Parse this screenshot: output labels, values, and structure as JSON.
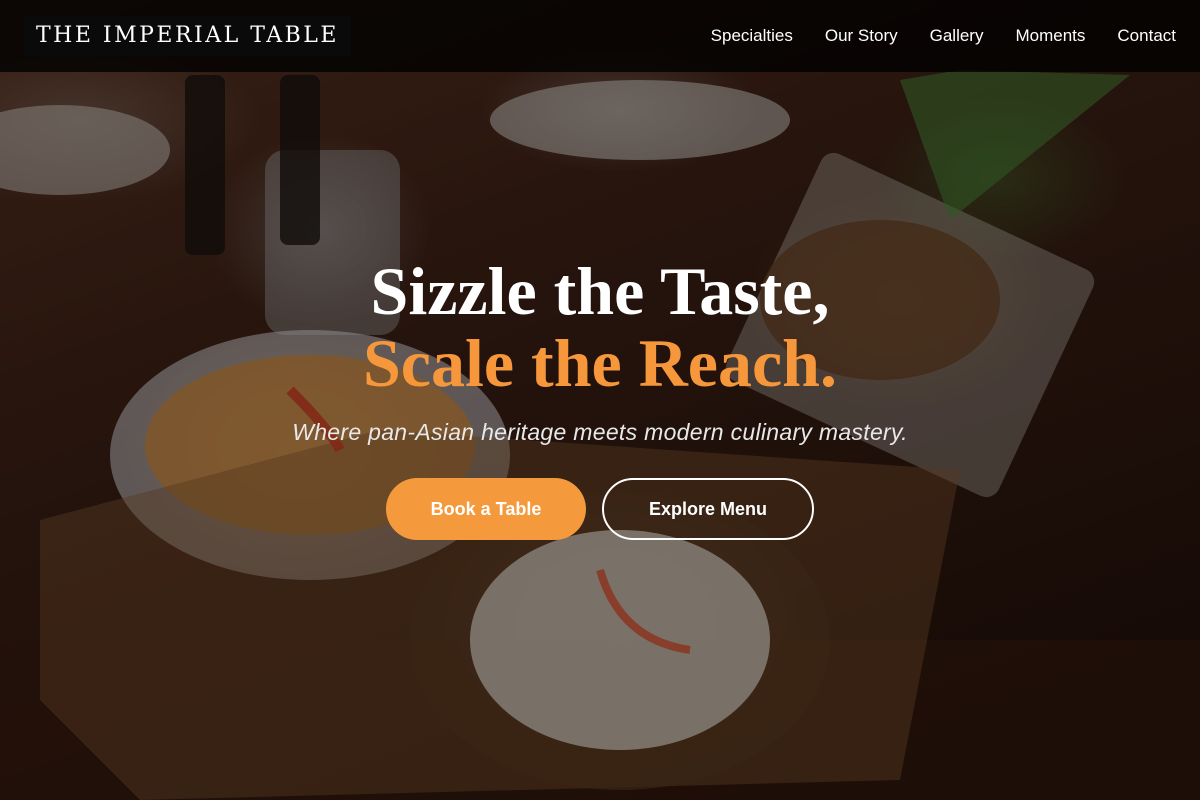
{
  "brand": {
    "name": "THE IMPERIAL TABLE"
  },
  "nav": {
    "items": [
      {
        "label": "Specialties"
      },
      {
        "label": "Our Story"
      },
      {
        "label": "Gallery"
      },
      {
        "label": "Moments"
      },
      {
        "label": "Contact"
      }
    ]
  },
  "hero": {
    "headline_line1": "Sizzle the Taste,",
    "headline_line2": "Scale the Reach.",
    "tagline": "Where pan-Asian heritage meets modern culinary mastery.",
    "primary_cta": "Book a Table",
    "secondary_cta": "Explore Menu"
  },
  "colors": {
    "accent": "#f59a3c",
    "nav_background": "#000000",
    "text": "#ffffff"
  }
}
